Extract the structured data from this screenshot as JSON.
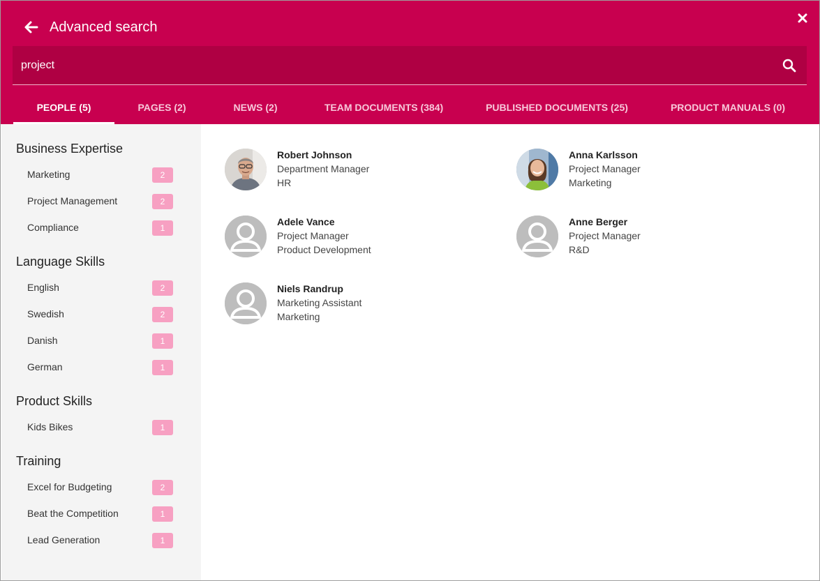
{
  "header": {
    "title": "Advanced search",
    "back_icon": "arrow-left-icon",
    "close_icon": "close-icon",
    "background": "#c8004f"
  },
  "search": {
    "value": "project",
    "icon": "search-icon"
  },
  "tabs": [
    {
      "label": "PEOPLE (5)",
      "active": true
    },
    {
      "label": "PAGES (2)",
      "active": false
    },
    {
      "label": "NEWS (2)",
      "active": false
    },
    {
      "label": "TEAM DOCUMENTS (384)",
      "active": false
    },
    {
      "label": "PUBLISHED DOCUMENTS (25)",
      "active": false
    },
    {
      "label": "PRODUCT MANUALS (0)",
      "active": false
    }
  ],
  "facets": [
    {
      "title": "Business Expertise",
      "items": [
        {
          "label": "Marketing",
          "count": "2"
        },
        {
          "label": "Project Management",
          "count": "2"
        },
        {
          "label": "Compliance",
          "count": "1"
        }
      ]
    },
    {
      "title": "Language Skills",
      "items": [
        {
          "label": "English",
          "count": "2"
        },
        {
          "label": "Swedish",
          "count": "2"
        },
        {
          "label": "Danish",
          "count": "1"
        },
        {
          "label": "German",
          "count": "1"
        }
      ]
    },
    {
      "title": "Product Skills",
      "items": [
        {
          "label": "Kids Bikes",
          "count": "1"
        }
      ]
    },
    {
      "title": "Training",
      "items": [
        {
          "label": "Excel for Budgeting",
          "count": "2"
        },
        {
          "label": "Beat the Competition",
          "count": "1"
        },
        {
          "label": "Lead Generation",
          "count": "1"
        }
      ]
    }
  ],
  "people": [
    {
      "name": "Robert Johnson",
      "role": "Department Manager",
      "dept": "HR",
      "photo": "photo-male"
    },
    {
      "name": "Anna Karlsson",
      "role": "Project Manager",
      "dept": "Marketing",
      "photo": "photo-female"
    },
    {
      "name": "Adele Vance",
      "role": "Project Manager",
      "dept": "Product Development",
      "photo": "placeholder"
    },
    {
      "name": "Anne Berger",
      "role": "Project Manager",
      "dept": "R&D",
      "photo": "placeholder"
    },
    {
      "name": "Niels Randrup",
      "role": "Marketing Assistant",
      "dept": "Marketing",
      "photo": "placeholder"
    }
  ]
}
